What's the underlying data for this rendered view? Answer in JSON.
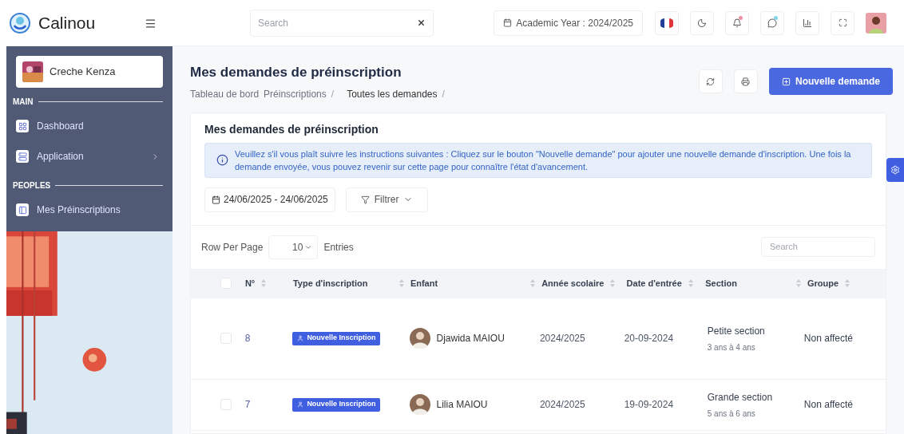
{
  "brand": "Calinou",
  "search": {
    "placeholder": "Search"
  },
  "academic_year": "Academic Year : 2024/2025",
  "sidebar": {
    "school": "Creche Kenza",
    "sections": [
      {
        "title": "MAIN",
        "items": [
          {
            "label": "Dashboard",
            "kind": "dashboard",
            "has_arrow": false
          },
          {
            "label": "Application",
            "kind": "app",
            "has_arrow": true
          }
        ]
      },
      {
        "title": "PEOPLES",
        "items": [
          {
            "label": "Mes Préinscriptions",
            "kind": "panel",
            "has_arrow": false
          }
        ]
      }
    ]
  },
  "page": {
    "title": "Mes demandes de préinscription",
    "breadcrumbs": [
      {
        "label": "Tableau de bord"
      },
      {
        "label": "Préinscriptions",
        "separator": "/"
      },
      {
        "label": "Toutes les demandes",
        "separator": "/"
      }
    ],
    "new_button": "Nouvelle demande"
  },
  "card": {
    "title": "Mes demandes de préinscription",
    "alert": "Veuillez s'il vous plaît suivre les instructions suivantes : Cliquez sur le bouton \"Nouvelle demande\" pour ajouter une nouvelle demande d'inscription. Une fois la demande envoyée, vous pouvez revenir sur cette page pour connaître l'état d'avancement.",
    "date_range": "24/06/2025 - 24/06/2025",
    "filter": "Filtrer",
    "rows_per_page": {
      "label": "Row Per Page",
      "value": "10",
      "suffix": "Entries"
    },
    "search_placeholder": "Search"
  },
  "table": {
    "select_all_checked": false,
    "columns": [
      {
        "label": "N°",
        "sortable": true
      },
      {
        "label": "Type d'inscription",
        "sortable": true
      },
      {
        "label": "Enfant",
        "sortable": true
      },
      {
        "label": "Année scolaire",
        "sortable": true
      },
      {
        "label": "Date d'entrée",
        "sortable": true
      },
      {
        "label": "Section",
        "sortable": true
      },
      {
        "label": "Groupe",
        "sortable": true
      }
    ],
    "rows": [
      {
        "checked": false,
        "number": "8",
        "type": "Nouvelle Inscription",
        "child": "Djawida MAIOU",
        "year": "2024/2025",
        "date": "20-09-2024",
        "section": "Petite section",
        "ages": "3 ans à 4 ans",
        "group": "Non affecté"
      },
      {
        "checked": false,
        "number": "7",
        "type": "Nouvelle Inscription",
        "child": "Lilia MAIOU",
        "year": "2024/2025",
        "date": "19-09-2024",
        "section": "Grande section",
        "ages": "5 ans à 6 ans",
        "group": "Non affecté"
      }
    ]
  }
}
